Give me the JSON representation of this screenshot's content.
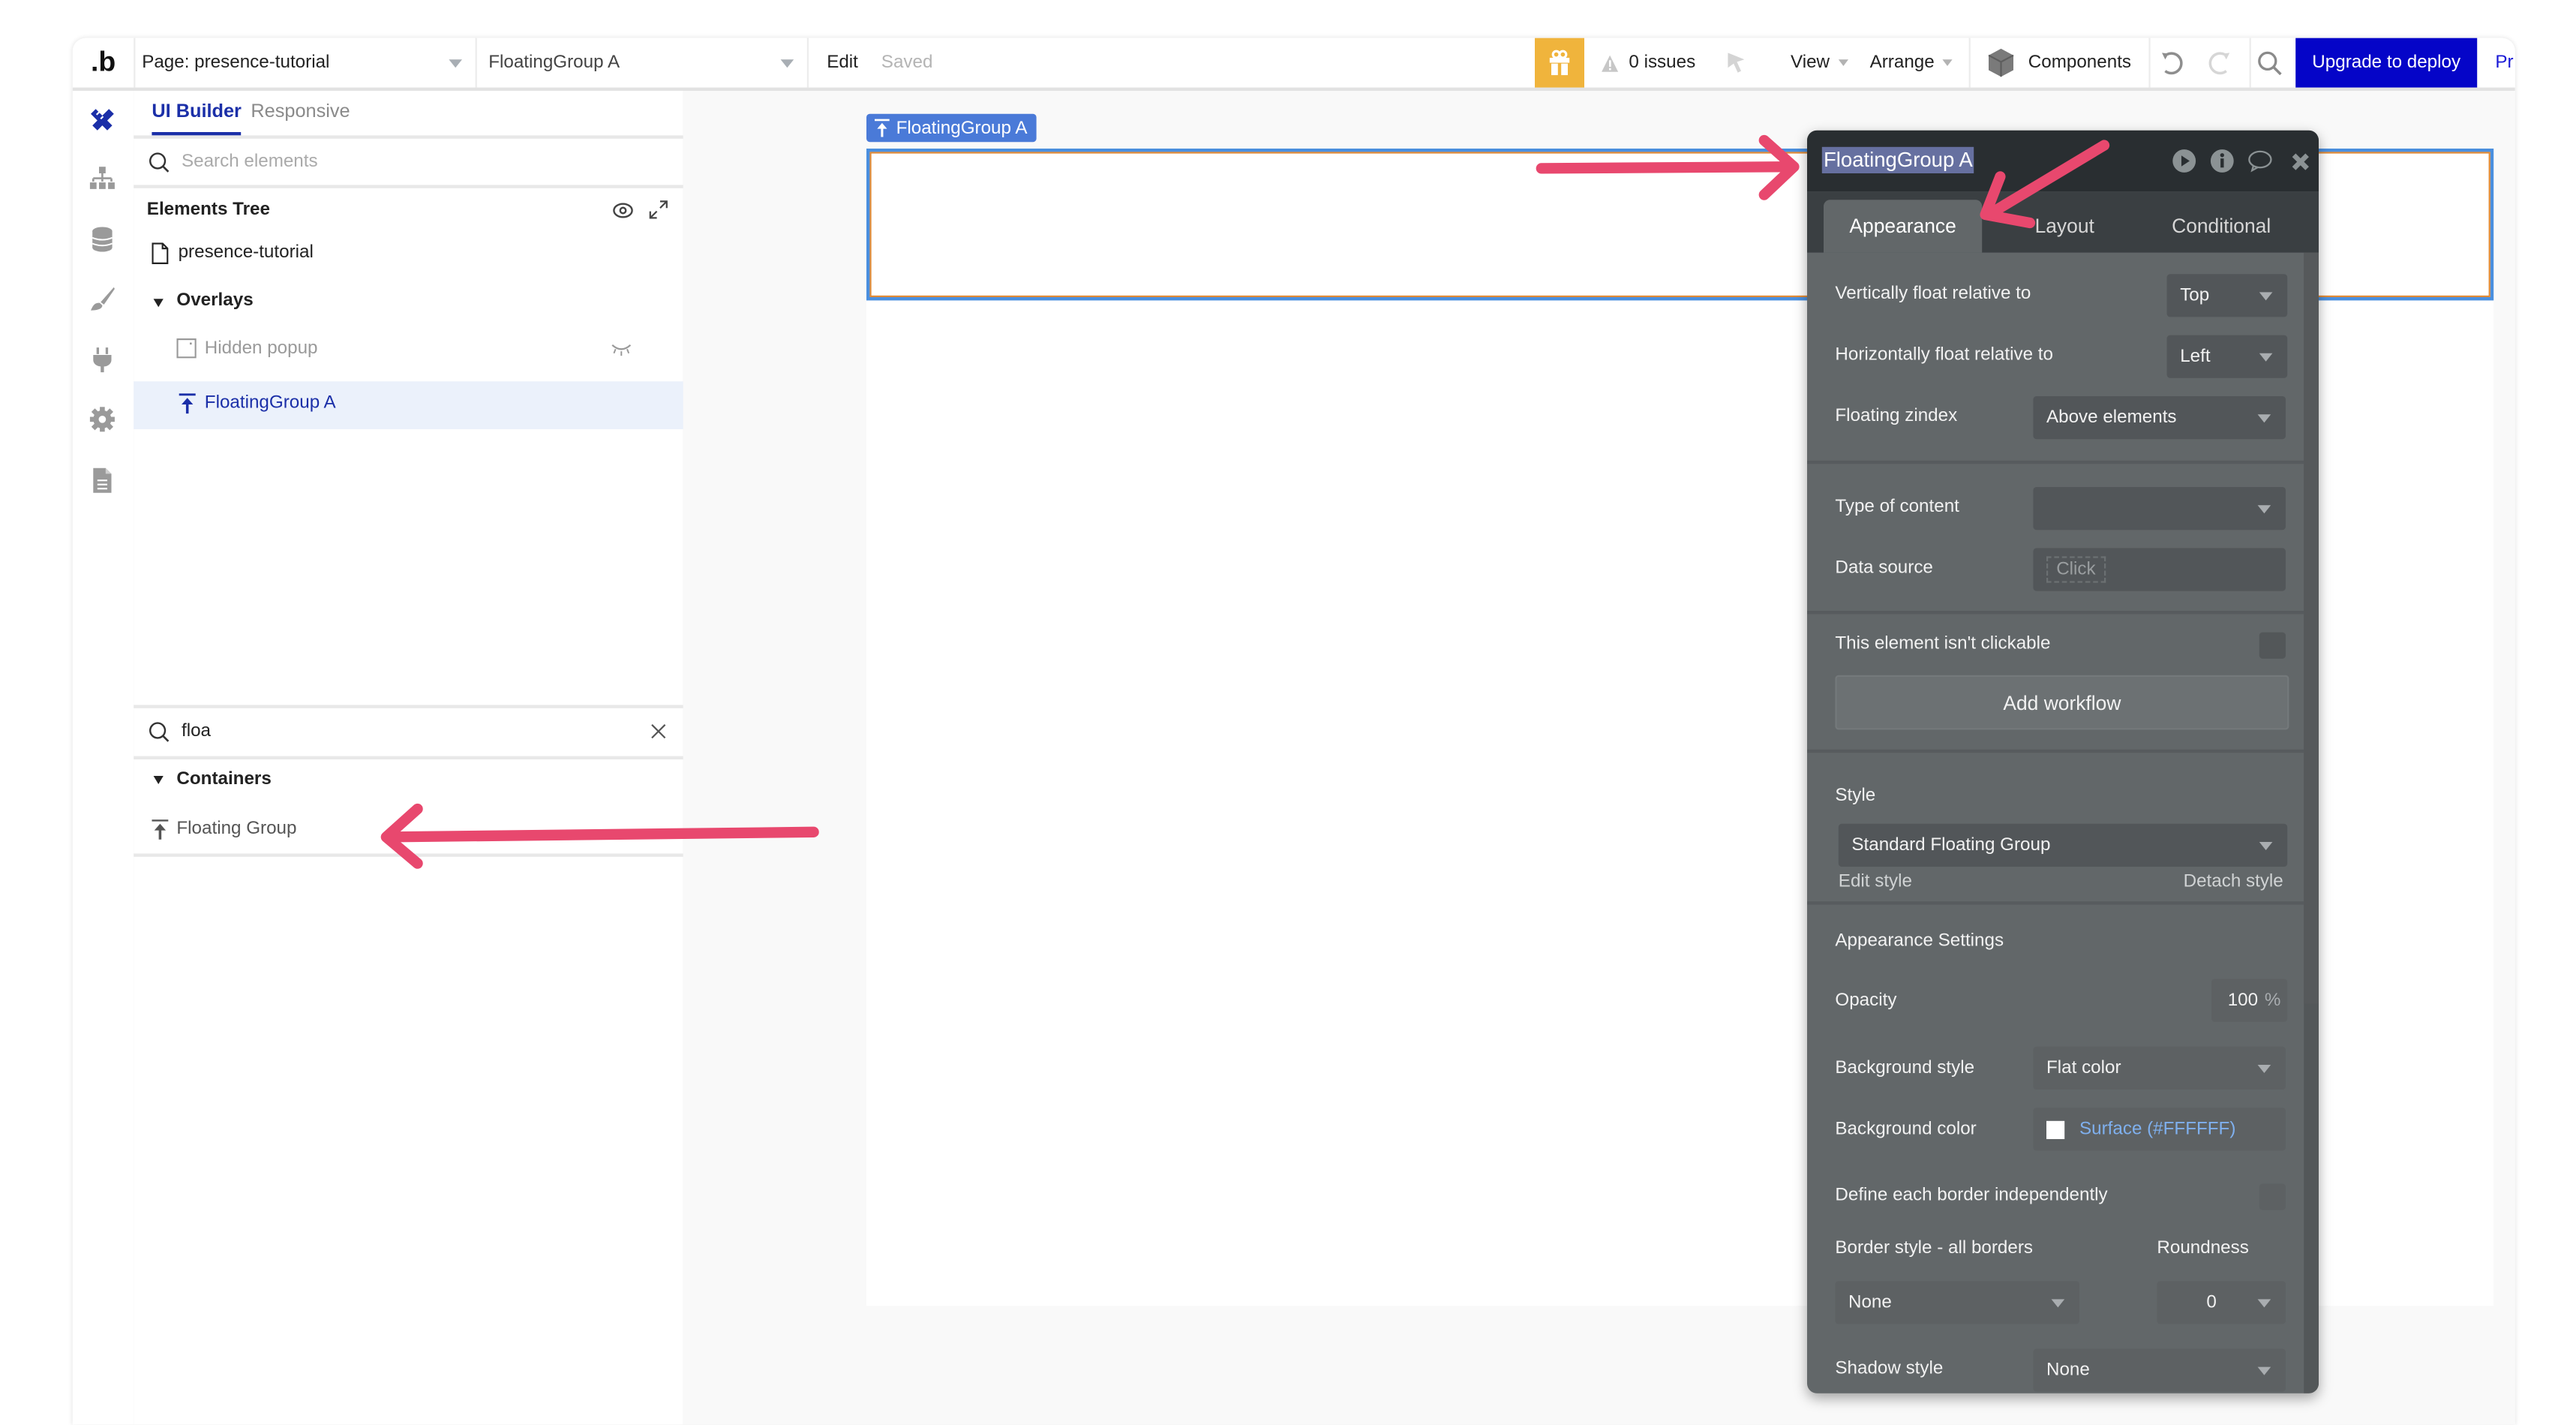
{
  "topbar": {
    "logo": ".b",
    "page_selector": "Page: presence-tutorial",
    "element_selector": "FloatingGroup A",
    "edit_label": "Edit",
    "saved_status": "Saved",
    "issues_label": "0 issues",
    "view_label": "View",
    "arrange_label": "Arrange",
    "components_label": "Components",
    "upgrade_label": "Upgrade to deploy",
    "preview_label_truncated": "Pr",
    "colors": {
      "gift": "#f0b43c",
      "upgrade": "#0505c8",
      "link": "#1a1ad6"
    }
  },
  "rail": {
    "icons": [
      "design-icon",
      "structure-icon",
      "data-icon",
      "styles-icon",
      "plugins-icon",
      "settings-icon",
      "logs-icon"
    ],
    "active_color": "#1b2fa8"
  },
  "left_panel": {
    "tabs": [
      {
        "label": "UI Builder",
        "active": true
      },
      {
        "label": "Responsive",
        "active": false
      }
    ],
    "search_placeholder": "Search elements",
    "tree_title": "Elements Tree",
    "tree": {
      "page": "presence-tutorial",
      "group": "Overlays",
      "items": [
        {
          "label": "Hidden popup",
          "hidden": true,
          "selected": false
        },
        {
          "label": "FloatingGroup A",
          "hidden": false,
          "selected": true
        }
      ]
    },
    "palette_search_value": "floa",
    "palette_category": "Containers",
    "palette_items": [
      "Floating Group"
    ]
  },
  "canvas": {
    "selected_label": "FloatingGroup A"
  },
  "props": {
    "title": "FloatingGroup A",
    "tabs": [
      {
        "label": "Appearance",
        "active": true
      },
      {
        "label": "Layout",
        "active": false
      },
      {
        "label": "Conditional",
        "active": false
      }
    ],
    "vertical_float_label": "Vertically float relative to",
    "vertical_float_value": "Top",
    "horizontal_float_label": "Horizontally float relative to",
    "horizontal_float_value": "Left",
    "zindex_label": "Floating zindex",
    "zindex_value": "Above elements",
    "content_type_label": "Type of content",
    "content_type_value": "",
    "data_source_label": "Data source",
    "data_source_placeholder": "Click",
    "not_clickable_label": "This element isn't clickable",
    "not_clickable_checked": false,
    "add_workflow_label": "Add workflow",
    "style_label": "Style",
    "style_value": "Standard Floating Group",
    "edit_style_label": "Edit style",
    "detach_style_label": "Detach style",
    "appearance_settings_label": "Appearance Settings",
    "opacity_label": "Opacity",
    "opacity_value": "100",
    "opacity_unit": "%",
    "bg_style_label": "Background style",
    "bg_style_value": "Flat color",
    "bg_color_label": "Background color",
    "bg_color_value": "Surface (#FFFFFF)",
    "bg_color_swatch": "#FFFFFF",
    "border_independent_label": "Define each border independently",
    "border_independent_checked": false,
    "border_style_label": "Border style - all borders",
    "border_style_value": "None",
    "roundness_label": "Roundness",
    "roundness_value": "0",
    "shadow_style_label": "Shadow style",
    "shadow_style_value": "None"
  },
  "annotations": {
    "arrow_color": "#e8486e",
    "arrows": [
      "arrow-to-floating-group-palette-item",
      "arrow-to-panel-title",
      "arrow-to-appearance-tab"
    ]
  }
}
